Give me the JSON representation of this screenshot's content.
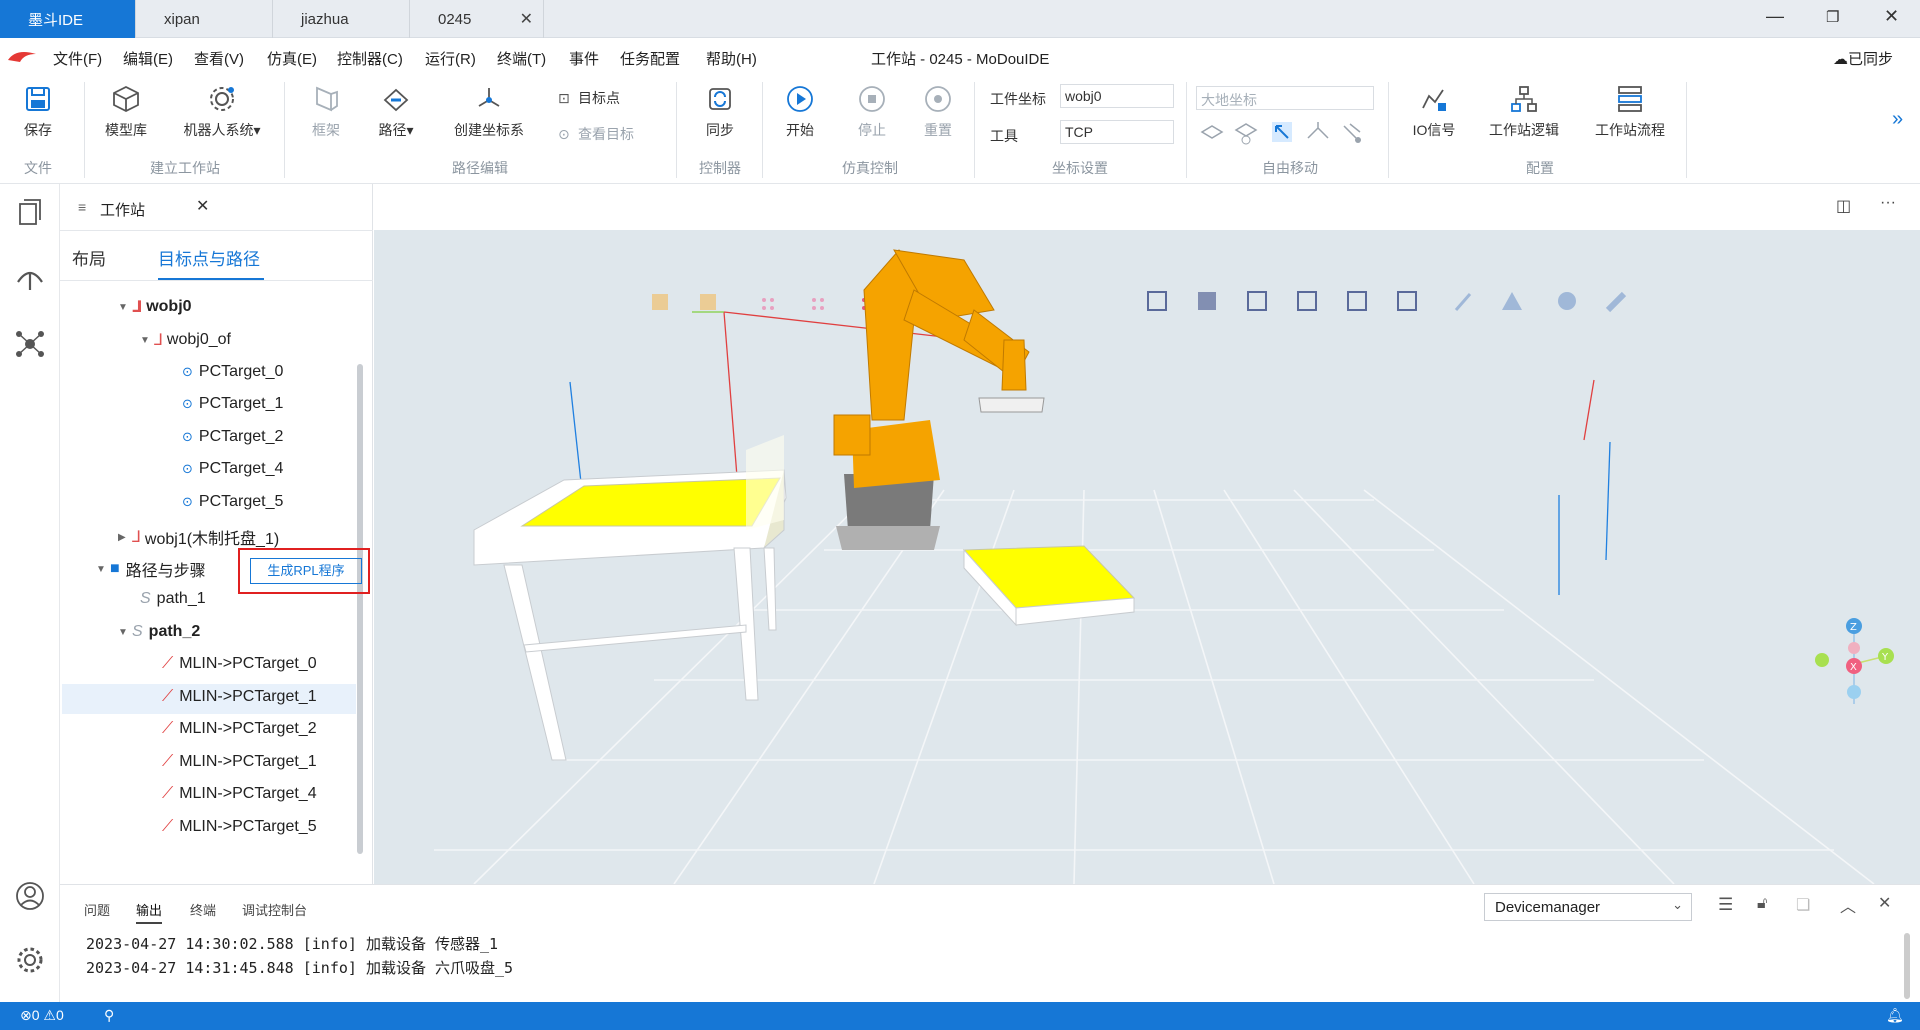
{
  "tabs": [
    {
      "label": "墨斗IDE",
      "active": true
    },
    {
      "label": "xipan",
      "active": false
    },
    {
      "label": "jiazhua",
      "active": false
    },
    {
      "label": "0245",
      "active": false,
      "closable": true
    }
  ],
  "window": {
    "title": "工作站 - 0245 - MoDouIDE",
    "sync_status": "已同步"
  },
  "menu": [
    "文件(F)",
    "编辑(E)",
    "查看(V)",
    "仿真(E)",
    "控制器(C)",
    "运行(R)",
    "终端(T)",
    "事件",
    "任务配置",
    "帮助(H)"
  ],
  "ribbon": {
    "save": "保存",
    "model_lib": "模型库",
    "robot_system": "机器人系统▾",
    "frame": "框架",
    "path": "路径▾",
    "create_coord": "创建坐标系",
    "target_point": "目标点",
    "view_target": "查看目标",
    "sync": "同步",
    "start": "开始",
    "stop": "停止",
    "reset": "重置",
    "work_coord_label": "工件坐标",
    "work_coord_value": "wobj0",
    "tool_label": "工具",
    "tool_value": "TCP",
    "earth_coord_placeholder": "大地坐标",
    "io_signal": "IO信号",
    "station_logic": "工作站逻辑",
    "station_flow": "工作站流程",
    "groups": {
      "file": "文件",
      "build_station": "建立工作站",
      "path_edit": "路径编辑",
      "controller": "控制器",
      "sim_control": "仿真控制",
      "coord_settings": "坐标设置",
      "free_move": "自由移动",
      "config": "配置"
    }
  },
  "panel": {
    "tab_title": "工作站",
    "subtab_layout": "布局",
    "subtab_targets": "目标点与路径",
    "tree": {
      "wobj0": "wobj0",
      "wobj0_of": "wobj0_of",
      "targets": [
        "PCTarget_0",
        "PCTarget_1",
        "PCTarget_2",
        "PCTarget_4",
        "PCTarget_5"
      ],
      "wobj1": "wobj1(木制托盘_1)",
      "paths_folder": "路径与步骤",
      "generate_btn": "生成RPL程序",
      "path_1": "path_1",
      "path_2": "path_2",
      "moves": [
        "MLIN->PCTarget_0",
        "MLIN->PCTarget_1",
        "MLIN->PCTarget_2",
        "MLIN->PCTarget_1",
        "MLIN->PCTarget_4",
        "MLIN->PCTarget_5"
      ]
    }
  },
  "bottom": {
    "tabs": [
      "问题",
      "输出",
      "终端",
      "调试控制台"
    ],
    "active_tab": "输出",
    "device_select": "Devicemanager",
    "logs": [
      "2023-04-27 14:30:02.588 [info] 加载设备 传感器_1",
      "2023-04-27 14:31:45.848 [info] 加载设备 六爪吸盘_5"
    ]
  },
  "status": {
    "errors": "0",
    "warnings": "0"
  },
  "colors": {
    "accent": "#1677d6",
    "robot": "#f5a300",
    "pallet": "#ffff00",
    "highlight_box": "#e02020"
  }
}
